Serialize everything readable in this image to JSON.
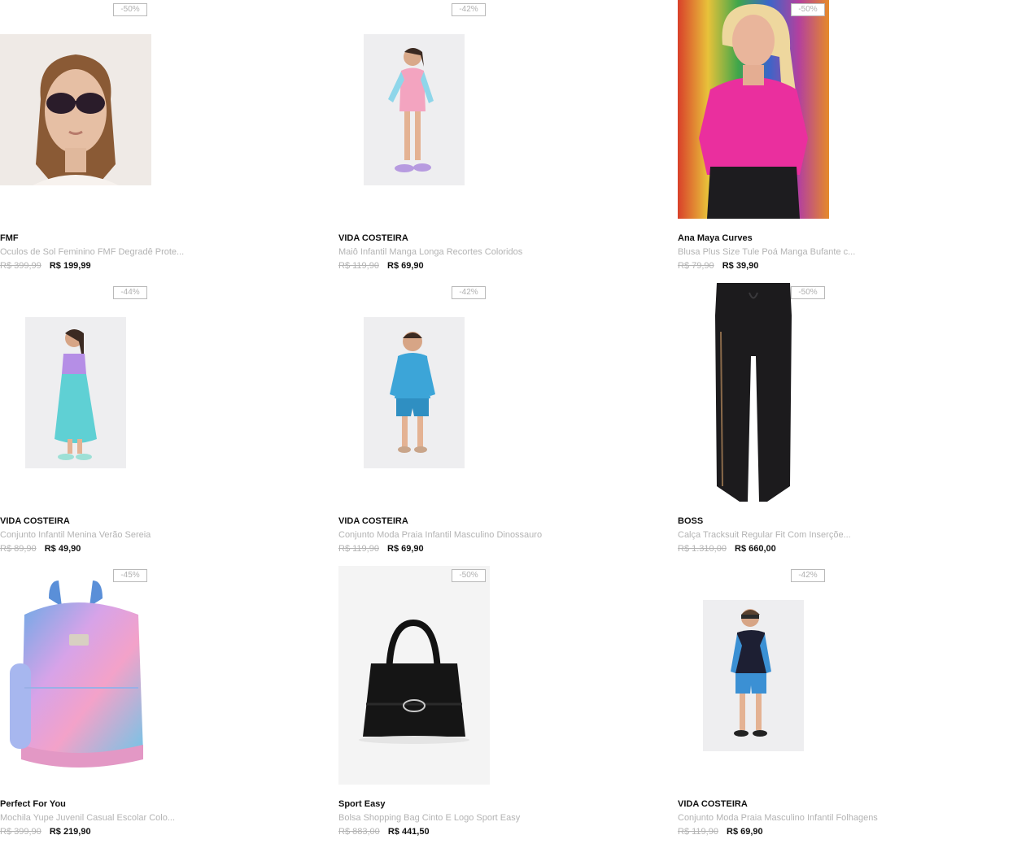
{
  "products": [
    {
      "discount": "-50%",
      "brand": "FMF",
      "name": "Oculos de Sol Feminino FMF Degradê Prote...",
      "old_price": "R$ 399,99",
      "price": "R$ 199,99",
      "image_icon": "sunglasses-woman-photo"
    },
    {
      "discount": "-42%",
      "brand": "VIDA COSTEIRA",
      "name": "Maiô Infantil Manga Longa Recortes Coloridos",
      "old_price": "R$ 119,90",
      "price": "R$ 69,90",
      "image_icon": "girl-swimsuit-photo"
    },
    {
      "discount": "-50%",
      "brand": "Ana Maya Curves",
      "name": "Blusa Plus Size Tule Poá Manga Bufante c...",
      "old_price": "R$ 79,90",
      "price": "R$ 39,90",
      "image_icon": "pink-blouse-model-photo"
    },
    {
      "discount": "-44%",
      "brand": "VIDA COSTEIRA",
      "name": "Conjunto Infantil Menina Verão Sereia",
      "old_price": "R$ 89,90",
      "price": "R$ 49,90",
      "image_icon": "girl-mermaid-dress-photo"
    },
    {
      "discount": "-42%",
      "brand": "VIDA COSTEIRA",
      "name": "Conjunto Moda Praia Infantil Masculino Dinossauro",
      "old_price": "R$ 119,90",
      "price": "R$ 69,90",
      "image_icon": "boy-beachwear-photo"
    },
    {
      "discount": "-50%",
      "brand": "BOSS",
      "name": "Calça Tracksuit Regular Fit Com Inserçõe...",
      "old_price": "R$ 1.310,00",
      "price": "R$ 660,00",
      "image_icon": "black-pants-photo"
    },
    {
      "discount": "-45%",
      "brand": "Perfect For You",
      "name": "Mochila Yupe Juvenil Casual Escolar Colo...",
      "old_price": "R$ 399,90",
      "price": "R$ 219,90",
      "image_icon": "tie-dye-backpack-photo"
    },
    {
      "discount": "-50%",
      "brand": "Sport Easy",
      "name": "Bolsa Shopping Bag Cinto E Logo Sport Easy",
      "old_price": "R$ 883,00",
      "price": "R$ 441,50",
      "image_icon": "black-handbag-photo"
    },
    {
      "discount": "-42%",
      "brand": "VIDA COSTEIRA",
      "name": "Conjunto Moda Praia Masculino Infantil Folhagens",
      "old_price": "R$ 119,90",
      "price": "R$ 69,90",
      "image_icon": "boy-rashguard-photo"
    }
  ]
}
